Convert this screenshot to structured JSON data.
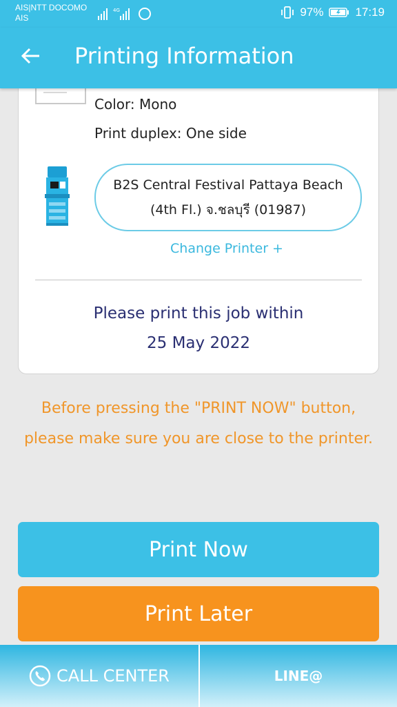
{
  "status_bar": {
    "carrier_line1": "AIS|NTT DOCOMO",
    "carrier_line2": "AIS",
    "battery": "97%",
    "time": "17:19"
  },
  "header": {
    "title": "Printing Information",
    "back_icon": "arrow-left-icon"
  },
  "job": {
    "color": "Color: Mono",
    "duplex": "Print duplex: One side",
    "printer_location": "B2S Central Festival Pattaya Beach (4th Fl.) จ.ชลบุรี (01987)",
    "change_printer": "Change Printer +",
    "deadline_line1": "Please print this job within",
    "deadline_line2": "25 May 2022"
  },
  "notice": "Before pressing the \"PRINT NOW\" button, please make sure you are close to the printer.",
  "actions": {
    "print_now": "Print Now",
    "print_later": "Print Later"
  },
  "bottom_nav": {
    "call_center": "CALL CENTER",
    "line": "LINE@"
  },
  "colors": {
    "primary": "#3cc0e6",
    "accent_orange": "#f7931e",
    "notice_orange": "#f0962a",
    "deadline_navy": "#2a2f72"
  }
}
